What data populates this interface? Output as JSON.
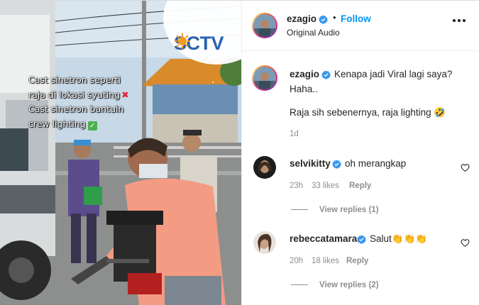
{
  "media": {
    "overlay_lines": [
      "Cast sinetron seperti",
      "raja di lokasi syuting",
      "Cast sinetron bantuin",
      "crew lighting"
    ],
    "overlay_marks": {
      "cross": "✖",
      "check": "✓"
    },
    "logo_text": "SCTV"
  },
  "post": {
    "author": "ezagio",
    "follow_label": "Follow",
    "separator": "•",
    "audio": "Original Audio",
    "caption": {
      "author": "ezagio",
      "text_line1": "Kenapa jadi Viral lagi saya?",
      "text_line2": "Haha..",
      "text_line3": "Raja sih sebenernya, raja lighting",
      "emoji": "🤣",
      "time": "1d"
    }
  },
  "comments": [
    {
      "user": "selvikitty",
      "text": "oh merangkap",
      "time": "23h",
      "likes": "33 likes",
      "reply_label": "Reply",
      "view_replies": "View replies (1)"
    },
    {
      "user": "rebeccatamara",
      "text": "Salut",
      "emoji": "👏👏👏",
      "time": "20h",
      "likes": "18 likes",
      "reply_label": "Reply",
      "view_replies": "View replies (2)"
    }
  ],
  "colors": {
    "accent": "#0095f6",
    "verified": "#3897f0",
    "muted": "#8e8e8e",
    "sctv_blue": "#2b62b0",
    "sctv_orange": "#f39c1e"
  }
}
